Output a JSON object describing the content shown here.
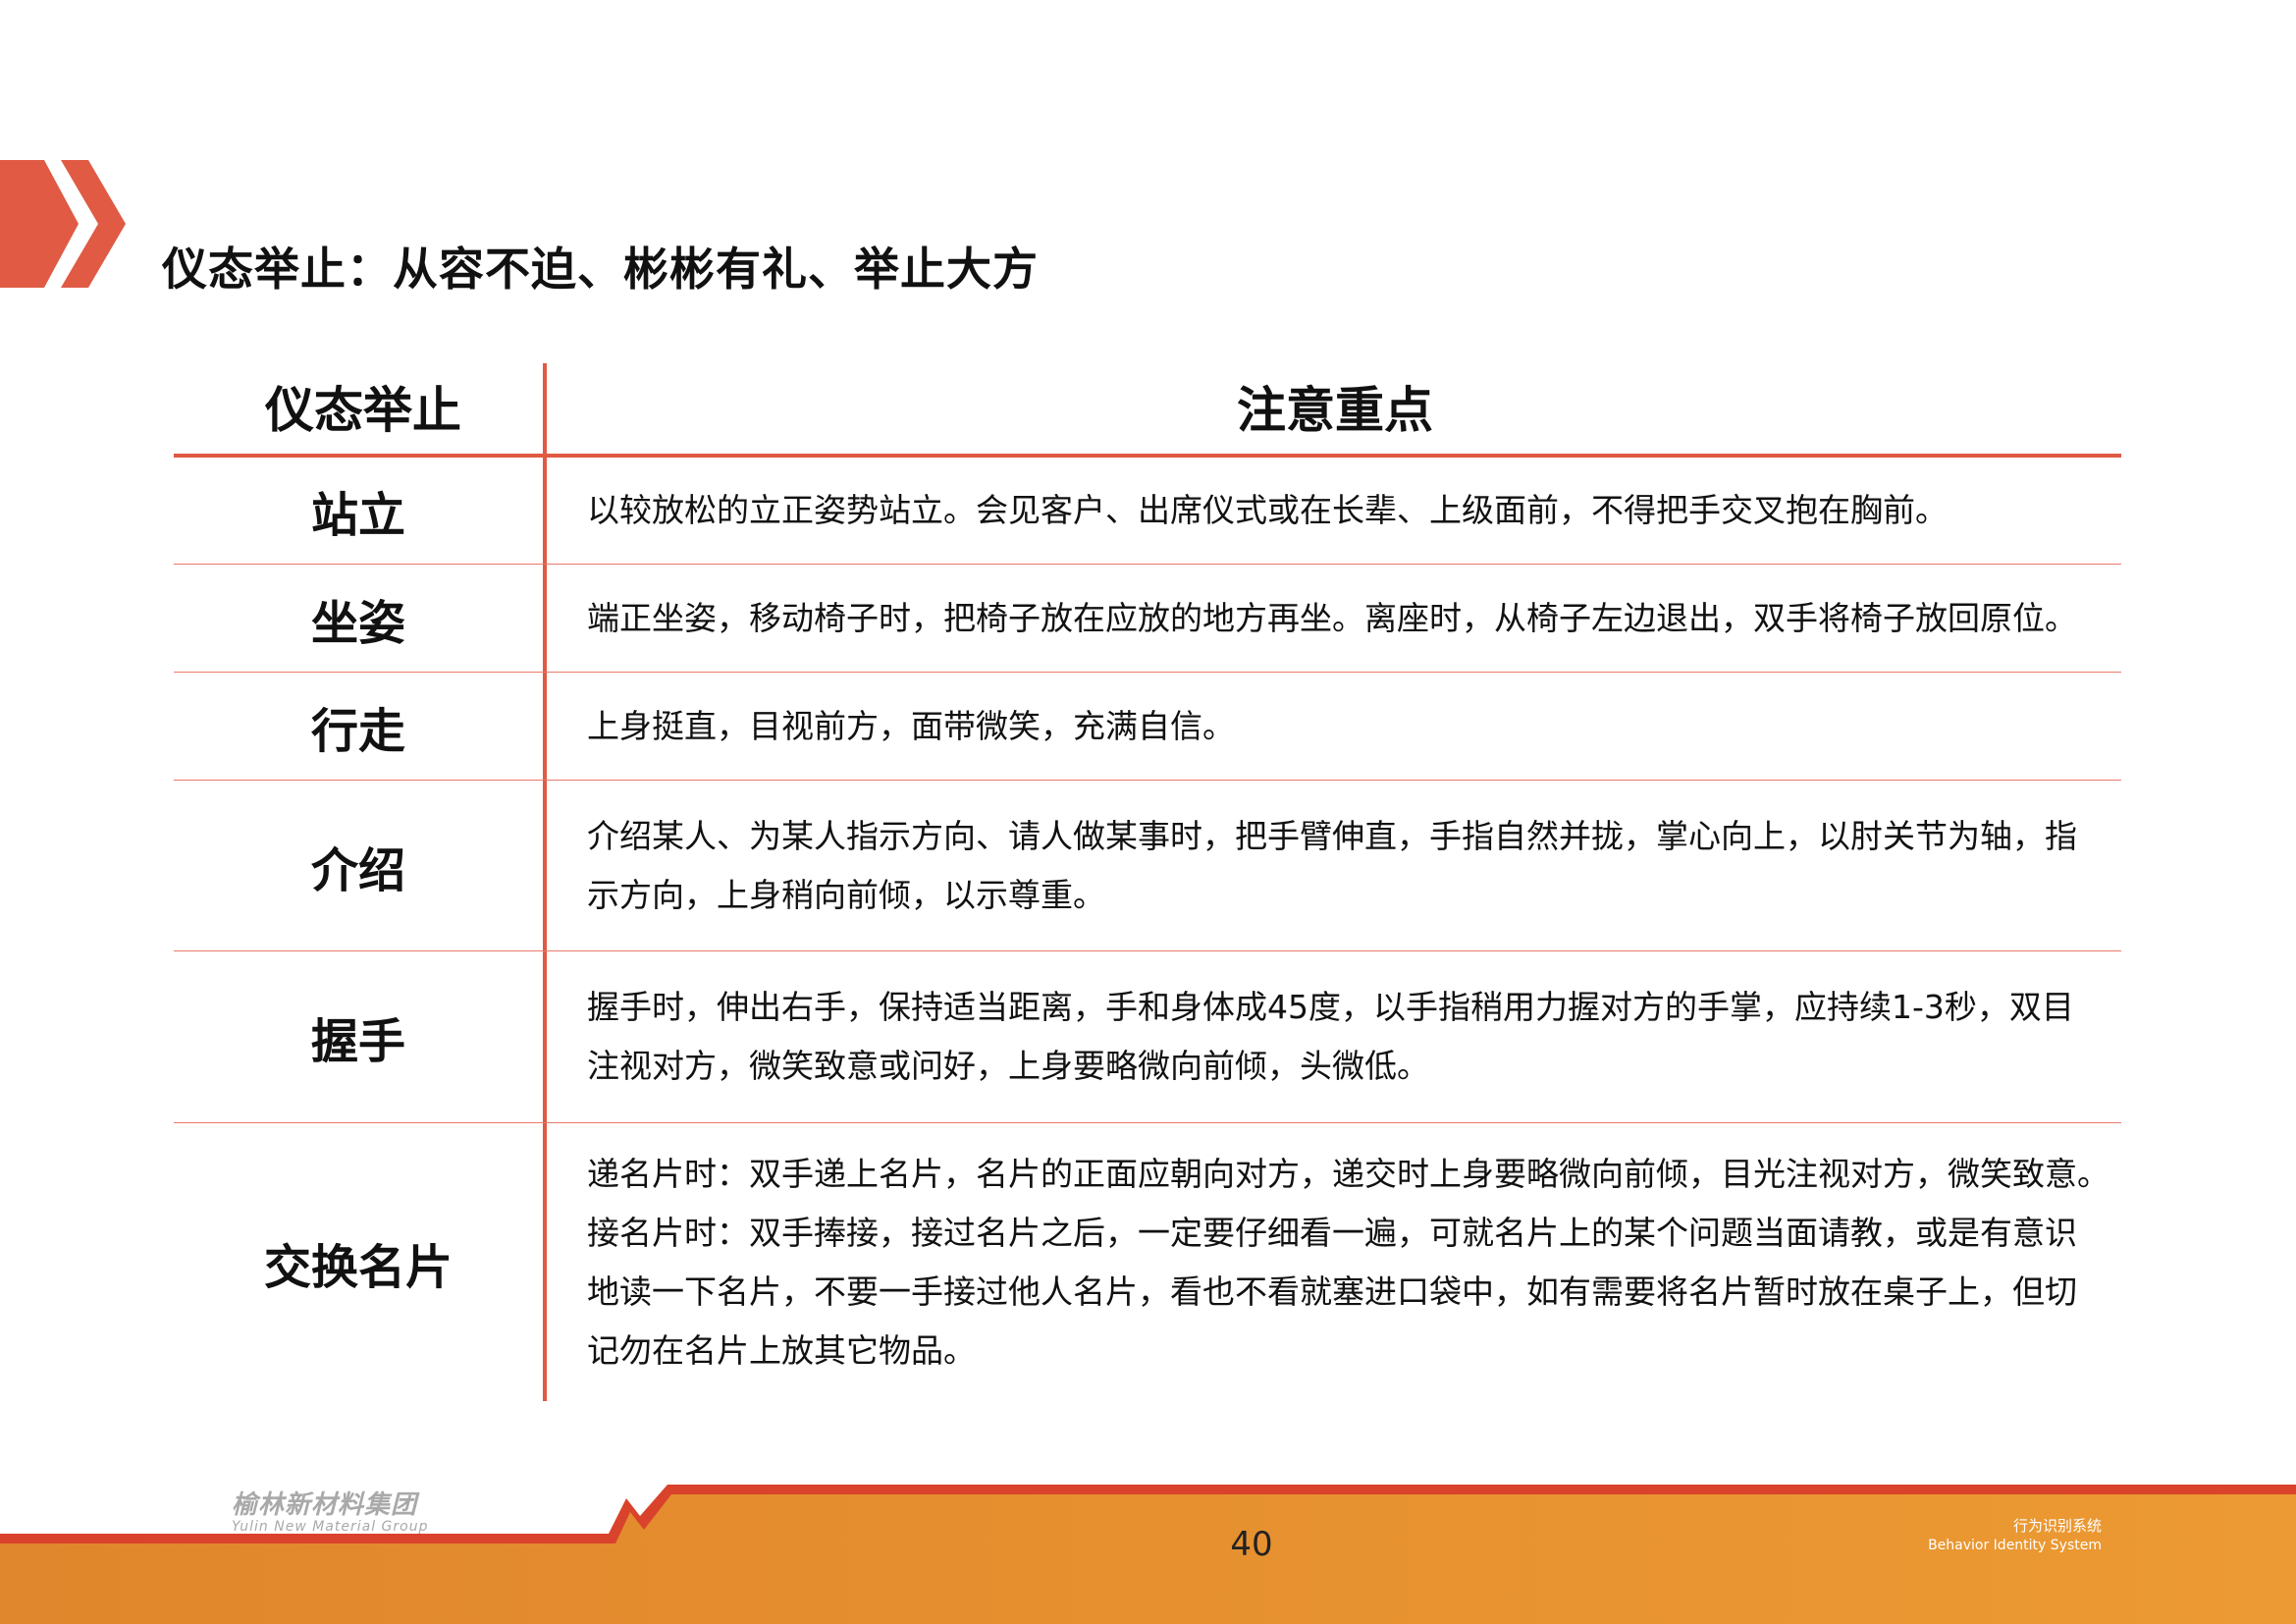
{
  "page": {
    "title": "仪态举止：从容不迫、彬彬有礼、举止大方",
    "page_number": "40"
  },
  "table": {
    "headers": [
      "仪态举止",
      "注意重点"
    ],
    "rows": [
      {
        "label": "站立",
        "text": "以较放松的立正姿势站立。会见客户、出席仪式或在长辈、上级面前，不得把手交叉抱在胸前。"
      },
      {
        "label": "坐姿",
        "text": "端正坐姿，移动椅子时，把椅子放在应放的地方再坐。离座时，从椅子左边退出，双手将椅子放回原位。"
      },
      {
        "label": "行走",
        "text": "上身挺直，目视前方，面带微笑，充满自信。"
      },
      {
        "label": "介绍",
        "text": "介绍某人、为某人指示方向、请人做某事时，把手臂伸直，手指自然并拢，掌心向上，以肘关节为轴，指\n示方向，上身稍向前倾，以示尊重。"
      },
      {
        "label": "握手",
        "text": "握手时，伸出右手，保持适当距离，手和身体成45度，以手指稍用力握对方的手掌，应持续1-3秒，双目\n注视对方，微笑致意或问好，上身要略微向前倾，头微低。"
      },
      {
        "label": "交换名片",
        "text": "递名片时：双手递上名片，名片的正面应朝向对方，递交时上身要略微向前倾，目光注视对方，微笑致意。\n接名片时：双手捧接，接过名片之后，一定要仔细看一遍，可就名片上的某个问题当面请教，或是有意识\n地读一下名片，不要一手接过他人名片，看也不看就塞进口袋中，如有需要将名片暂时放在桌子上，但切\n记勿在名片上放其它物品。"
      }
    ]
  },
  "footer": {
    "logo_cn": "榆林新材料集团",
    "logo_en": "Yulin New Material Group",
    "system_cn": "行为识别系统",
    "system_en": "Behavior Identity System"
  },
  "colors": {
    "accent": "#e05a44",
    "footer_orange": "#e8922e",
    "footer_red": "#d9432c"
  }
}
